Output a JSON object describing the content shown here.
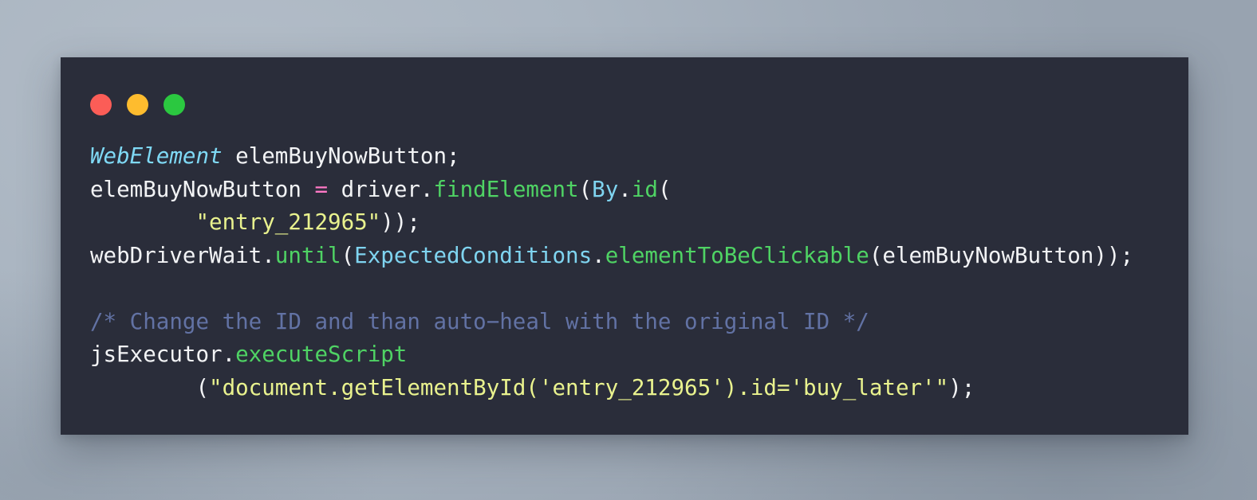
{
  "window": {
    "title_bar": {
      "buttons": [
        {
          "name": "close-button",
          "label": "close",
          "color": "#fb5d57"
        },
        {
          "name": "minimize-button",
          "label": "minimize",
          "color": "#febc2e"
        },
        {
          "name": "maximize-button",
          "label": "maximize",
          "color": "#2bc840"
        }
      ]
    },
    "background_color": "#2a2d3a",
    "page_background_color": "#aab4c0"
  },
  "theme": {
    "plain": "#f2f3f5",
    "type": "#7fd9f5",
    "class": "#7fd4f0",
    "function": "#4fd364",
    "string": "#e9f28e",
    "operator": "#ff79c6",
    "comment": "#6272a4"
  },
  "code": {
    "language": "java",
    "full_text": "WebElement elemBuyNowButton;\nelemBuyNowButton = driver.findElement(By.id(\n        \"entry_212965\"));\nwebDriverWait.until(ExpectedConditions.elementToBeClickable(elemBuyNowButton));\n\n/* Change the ID and than auto-heal with the original ID */\njsExecutor.executeScript\n        (\"document.getElementById('entry_212965').id='buy_later'\");",
    "lines": [
      {
        "index": 1,
        "tokens": [
          {
            "t": "WebElement",
            "c": "type"
          },
          {
            "t": " elemBuyNowButton;",
            "c": "plain"
          }
        ]
      },
      {
        "index": 2,
        "tokens": [
          {
            "t": "elemBuyNowButton ",
            "c": "plain"
          },
          {
            "t": "=",
            "c": "op"
          },
          {
            "t": " driver.",
            "c": "plain"
          },
          {
            "t": "findElement",
            "c": "func"
          },
          {
            "t": "(",
            "c": "plain"
          },
          {
            "t": "By",
            "c": "class"
          },
          {
            "t": ".",
            "c": "plain"
          },
          {
            "t": "id",
            "c": "func"
          },
          {
            "t": "(",
            "c": "plain"
          }
        ]
      },
      {
        "index": 3,
        "tokens": [
          {
            "t": "        ",
            "c": "plain"
          },
          {
            "t": "\"entry_212965\"",
            "c": "string"
          },
          {
            "t": "));",
            "c": "plain"
          }
        ]
      },
      {
        "index": 4,
        "tokens": [
          {
            "t": "webDriverWait.",
            "c": "plain"
          },
          {
            "t": "until",
            "c": "func"
          },
          {
            "t": "(",
            "c": "plain"
          },
          {
            "t": "ExpectedConditions",
            "c": "class"
          },
          {
            "t": ".",
            "c": "plain"
          },
          {
            "t": "elementToBeClickable",
            "c": "func"
          },
          {
            "t": "(elemBuyNowButton));",
            "c": "plain"
          }
        ]
      },
      {
        "index": 5,
        "tokens": [
          {
            "t": "",
            "c": "plain"
          }
        ]
      },
      {
        "index": 6,
        "tokens": [
          {
            "t": "/* Change the ID and than auto−heal with the original ID */",
            "c": "comment"
          }
        ]
      },
      {
        "index": 7,
        "tokens": [
          {
            "t": "jsExecutor.",
            "c": "plain"
          },
          {
            "t": "executeScript",
            "c": "func"
          }
        ]
      },
      {
        "index": 8,
        "tokens": [
          {
            "t": "        (",
            "c": "plain"
          },
          {
            "t": "\"document.getElementById('entry_212965').id='buy_later'\"",
            "c": "string"
          },
          {
            "t": ");",
            "c": "plain"
          }
        ]
      }
    ]
  }
}
